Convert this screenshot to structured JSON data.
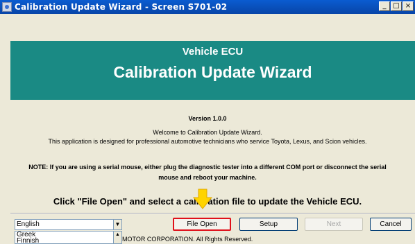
{
  "window": {
    "title": "Calibration Update Wizard - Screen S701-02",
    "buttons": {
      "minimize": "_",
      "maximize": "□",
      "close": "×"
    }
  },
  "banner": {
    "line1": "Vehicle ECU",
    "line2": "Calibration Update Wizard"
  },
  "content": {
    "version": "Version 1.0.0",
    "welcome_line1": "Welcome to Calibration Update Wizard.",
    "welcome_line2": "This application is designed for professional automotive technicians who service Toyota, Lexus, and Scion vehicles.",
    "note_line1": "NOTE: If you are using a serial mouse, either plug the diagnostic tester into a different COM port or disconnect the serial",
    "note_line2": "mouse and reboot your machine.",
    "instruction": "Click \"File Open\" and select a calibration file to update the Vehicle ECU."
  },
  "language": {
    "selected": "English",
    "options": [
      "Greek",
      "Finnish"
    ]
  },
  "buttons": {
    "file_open": "File Open",
    "setup": "Setup",
    "next": "Next",
    "cancel": "Cancel"
  },
  "footer": {
    "copyright": "MOTOR CORPORATION. All Rights Reserved."
  },
  "colors": {
    "banner": "#1a8a84",
    "highlight_border": "#e0101a",
    "arrow": "#ffd400"
  }
}
